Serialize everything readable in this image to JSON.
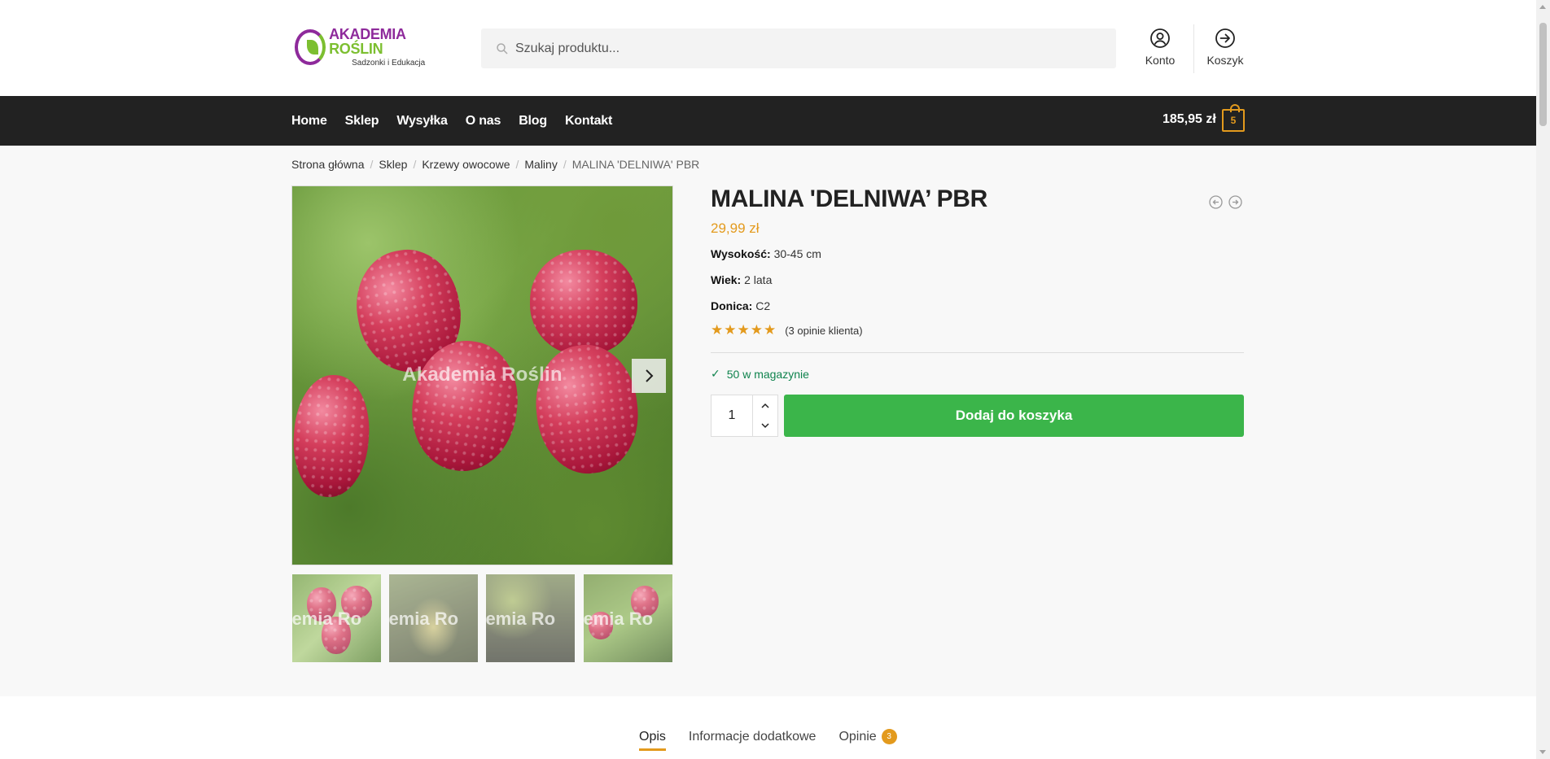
{
  "header": {
    "logo": {
      "brand_part1": "AKADEMIA ",
      "brand_part2": "ROŚLIN",
      "tagline": "Sadzonki i Edukacja"
    },
    "search": {
      "placeholder": "Szukaj produktu...",
      "value": ""
    },
    "account_label": "Konto",
    "cart_link_label": "Koszyk"
  },
  "nav": {
    "items": [
      {
        "label": "Home"
      },
      {
        "label": "Sklep"
      },
      {
        "label": "Wysyłka"
      },
      {
        "label": "O nas"
      },
      {
        "label": "Blog"
      },
      {
        "label": "Kontakt"
      }
    ],
    "cart_total": "185,95 zł",
    "cart_count": "5"
  },
  "breadcrumb": {
    "items": [
      "Strona główna",
      "Sklep",
      "Krzewy owocowe",
      "Maliny"
    ],
    "current": "MALINA 'DELNIWA' PBR",
    "separator": "/"
  },
  "gallery": {
    "watermark": "Akademia Roślin",
    "thumb_watermark": "demia Ro",
    "thumbnail_count": 4
  },
  "product": {
    "title": "MALINA 'DELNIWA’ PBR",
    "price": "29,99 zł",
    "attributes": [
      {
        "label": "Wysokość:",
        "value": "30-45 cm"
      },
      {
        "label": "Wiek:",
        "value": "2 lata"
      },
      {
        "label": "Donica:",
        "value": "C2"
      }
    ],
    "rating": {
      "stars": "★★★★★",
      "value": 5,
      "reviews_text": "(3 opinie klienta)"
    },
    "stock": "50 w magazynie",
    "quantity": "1",
    "add_to_cart_label": "Dodaj do koszyka"
  },
  "tabs": {
    "items": [
      {
        "label": "Opis",
        "active": true
      },
      {
        "label": "Informacje dodatkowe",
        "active": false
      },
      {
        "label": "Opinie",
        "active": false,
        "badge": "3"
      }
    ]
  },
  "colors": {
    "accent": "#e39a1d",
    "nav_bg": "#222222",
    "add_to_cart": "#3bb54a",
    "stock": "#0f834d",
    "brand_purple": "#8e2a9b",
    "brand_green": "#7cbf30"
  }
}
